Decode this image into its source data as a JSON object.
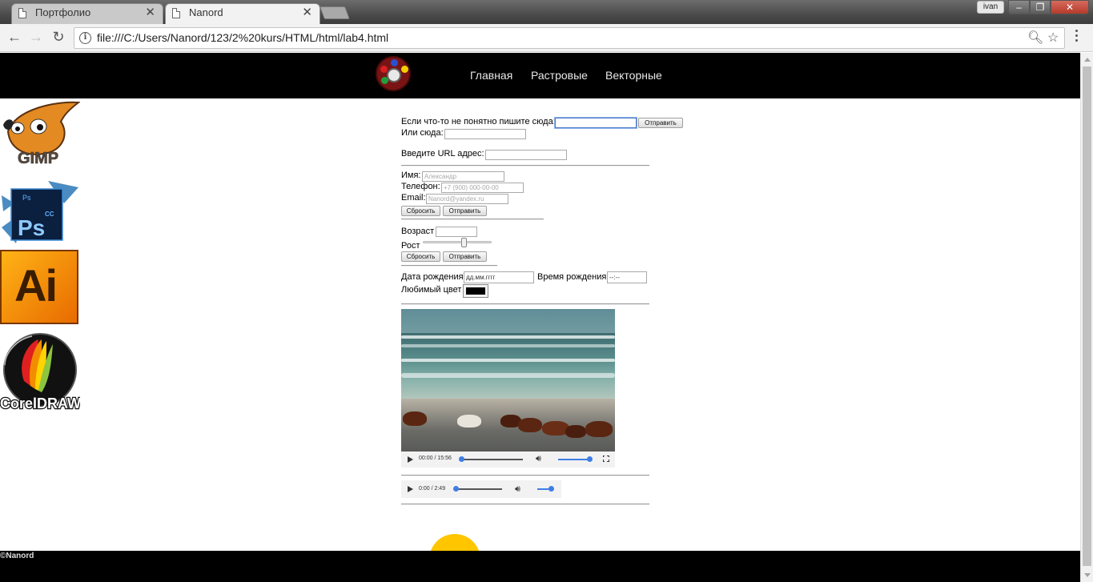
{
  "browser": {
    "tabs": [
      {
        "title": "Портфолио"
      },
      {
        "title": "Nanord"
      }
    ],
    "profile": "ivan",
    "url": "file:///C:/Users/Nanord/123/2%20kurs/HTML/html/lab4.html"
  },
  "header": {
    "nav": [
      "Главная",
      "Растровые",
      "Векторные"
    ]
  },
  "sidebar": {
    "icons": [
      {
        "name": "gimp",
        "label": "GIMP"
      },
      {
        "name": "photoshop",
        "label": "Ps",
        "badge": "CC"
      },
      {
        "name": "illustrator",
        "label": "Ai"
      },
      {
        "name": "coreldraw",
        "label": "CorelDRAW"
      }
    ]
  },
  "form": {
    "feedback_label": "Если что-то не понятно пишите сюда:",
    "feedback_submit": "Отправить",
    "or_here_label": "Или сюда:",
    "url_label": "Введите URL адрес:",
    "name_label": "Имя:",
    "name_placeholder": "Александр",
    "phone_label": "Телефон:",
    "phone_placeholder": "+7 (900) 000-00-00",
    "email_label": "Email:",
    "email_placeholder": "Nanord@yandex.ru",
    "reset_label": "Сбросить",
    "submit_label": "Отправить",
    "age_label": "Возраст",
    "height_label": "Рост",
    "height_slider_value": 0.6,
    "reset2_label": "Сбросить",
    "submit2_label": "Отправить",
    "birthdate_label": "Дата рождения",
    "birthdate_placeholder": "дд.мм.гггг",
    "birthtime_label": "Время рождения",
    "birthtime_placeholder": "--:--",
    "favcolor_label": "Любимый цвет",
    "favcolor_value": "#000000"
  },
  "video": {
    "time": "00:00 / 15:56",
    "progress": 0,
    "volume": 1
  },
  "audio": {
    "time": "0:00 / 2:49",
    "progress": 0,
    "volume": 1
  },
  "footer": {
    "copyright": "©Nanord"
  },
  "colors": {
    "header_bg": "#000000",
    "accent_blue": "#3d7ee6",
    "sun_yellow": "#ffc600"
  }
}
